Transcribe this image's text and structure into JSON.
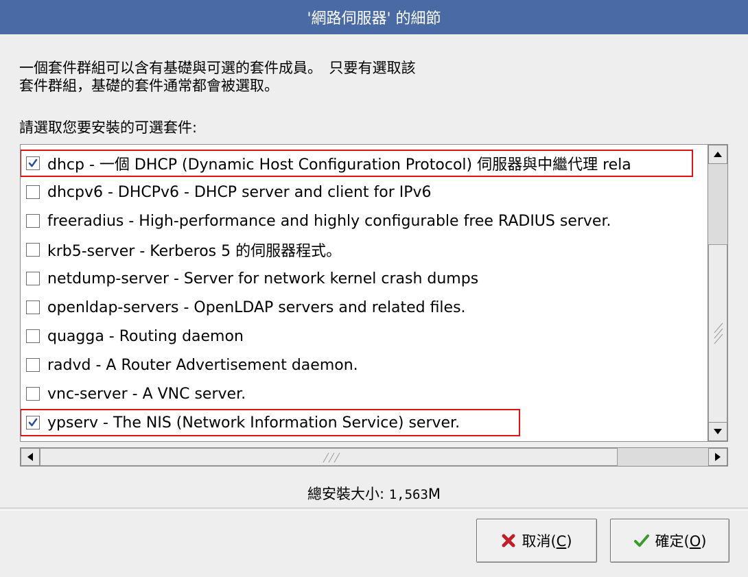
{
  "window": {
    "title": "'網路伺服器' 的細節"
  },
  "description": "一個套件群組可以含有基礎與可選的套件成員。　只要有選取該\n套件群組，基礎的套件通常都會被選取。",
  "prompt": "請選取您要安裝的可選套件:",
  "packages": [
    {
      "label": "dhcp - 一個 DHCP (Dynamic Host Configuration Protocol) 伺服器與中繼代理 rela",
      "checked": true,
      "highlighted": true
    },
    {
      "label": "dhcpv6 - DHCPv6 - DHCP server and client for IPv6",
      "checked": false,
      "highlighted": false
    },
    {
      "label": "freeradius - High-performance and highly configurable free RADIUS server.",
      "checked": false,
      "highlighted": false
    },
    {
      "label": "krb5-server - Kerberos 5 的伺服器程式。",
      "checked": false,
      "highlighted": false
    },
    {
      "label": "netdump-server - Server for network kernel crash dumps",
      "checked": false,
      "highlighted": false
    },
    {
      "label": "openldap-servers - OpenLDAP servers and related files.",
      "checked": false,
      "highlighted": false
    },
    {
      "label": "quagga - Routing daemon",
      "checked": false,
      "highlighted": false
    },
    {
      "label": "radvd - A Router Advertisement daemon.",
      "checked": false,
      "highlighted": false
    },
    {
      "label": "vnc-server - A VNC server.",
      "checked": false,
      "highlighted": false
    },
    {
      "label": "ypserv - The NIS (Network Information Service) server.",
      "checked": true,
      "highlighted": true
    }
  ],
  "total_size": {
    "label": "總安裝大小:",
    "value": "1,563",
    "unit": "M"
  },
  "buttons": {
    "cancel": {
      "label": "取消(",
      "mnemonic": "C",
      "suffix": ")"
    },
    "ok": {
      "label": "確定(",
      "mnemonic": "O",
      "suffix": ")"
    }
  },
  "colors": {
    "titlebar": "#4a6aa5",
    "highlight_border": "#dd1111",
    "checkmark": "#2a4f9a"
  },
  "icons": {
    "cancel": "red-x-icon",
    "ok": "green-check-icon"
  }
}
